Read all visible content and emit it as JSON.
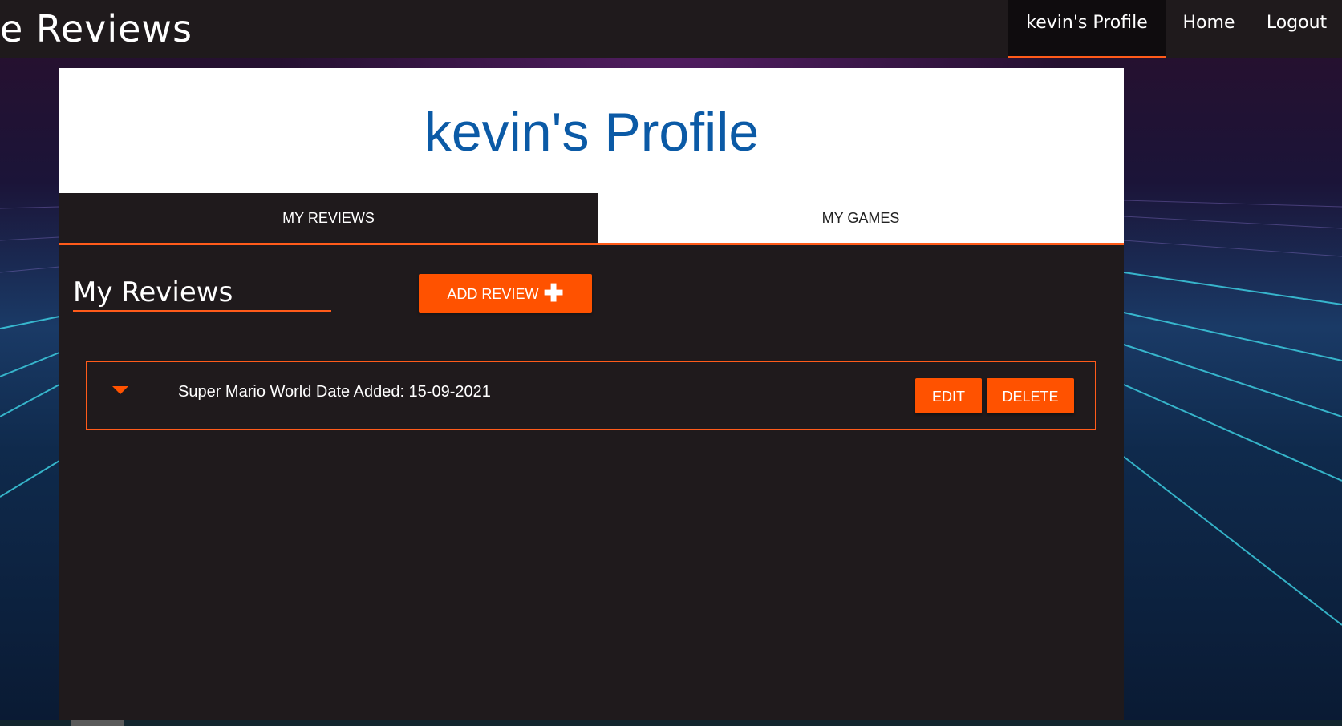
{
  "navbar": {
    "brand": "e Reviews",
    "items": [
      {
        "label": "kevin's Profile",
        "active": true
      },
      {
        "label": "Home",
        "active": false
      },
      {
        "label": "Logout",
        "active": false
      }
    ]
  },
  "profile": {
    "title": "kevin's Profile"
  },
  "tabs": [
    {
      "label": "MY REVIEWS",
      "active": true
    },
    {
      "label": "MY GAMES",
      "active": false
    }
  ],
  "reviews_section": {
    "title": "My Reviews",
    "add_button_label": "ADD REVIEW",
    "add_button_icon": "plus-icon",
    "items": [
      {
        "text": "Super Mario World Date Added: 15-09-2021",
        "edit_label": "EDIT",
        "delete_label": "DELETE"
      }
    ]
  },
  "colors": {
    "accent": "#ff5200",
    "title_blue": "#0b5aa6",
    "panel": "#1f1a1c"
  }
}
